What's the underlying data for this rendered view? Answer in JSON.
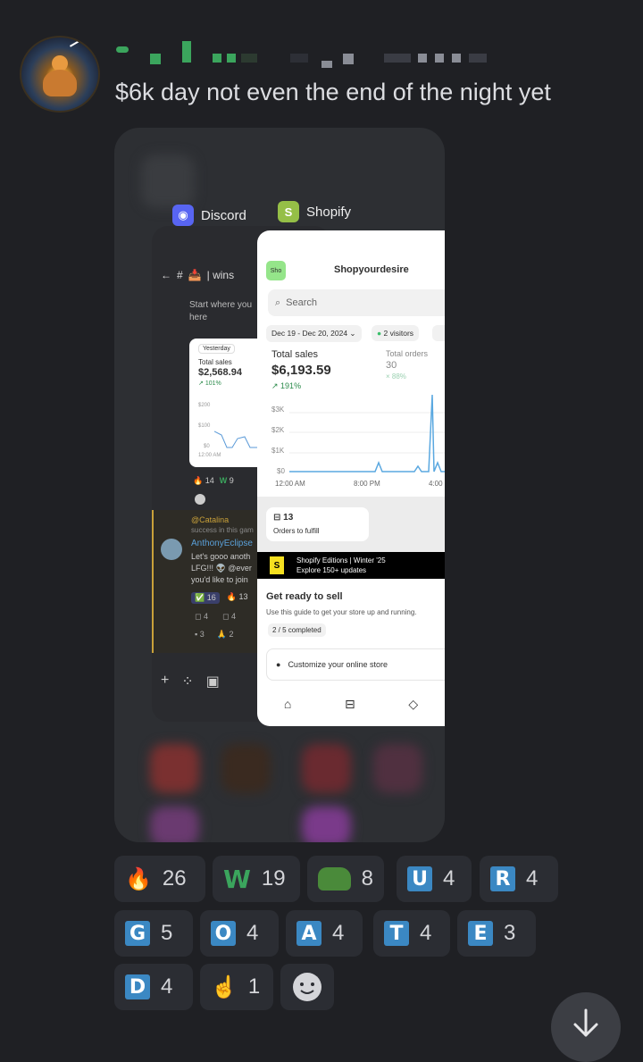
{
  "message": {
    "text": "$6k day not even the end of the night yet"
  },
  "screenshot": {
    "discord": {
      "app_name": "Discord",
      "channel": "| wins",
      "snippet_lines": [
        "Start where you",
        "here"
      ],
      "card": {
        "range": "Yesterday",
        "label": "Total sales",
        "value": "$2,568.94",
        "change": "101%",
        "ticks": [
          "$200",
          "$100",
          "$0"
        ],
        "time": "12:00 AM"
      },
      "reactions": [
        {
          "emoji": "🔥",
          "count": "14"
        },
        {
          "emoji": "W",
          "count": "9"
        }
      ],
      "reply": {
        "mention": "@Catalina",
        "sub": "success in this gam"
      },
      "author": "AnthonyEclipse",
      "body_lines": [
        "Let's gooo anoth",
        "LFG!!! 👽 @ever",
        "you'd like to join"
      ],
      "reactions2": [
        {
          "emoji": "✅",
          "count": "16"
        },
        {
          "emoji": "🔥",
          "count": "13"
        }
      ],
      "reactions3": [
        {
          "emoji": "",
          "count": "4"
        },
        {
          "emoji": "",
          "count": "4"
        }
      ],
      "reactions4": [
        {
          "emoji": "",
          "count": "3"
        },
        {
          "emoji": "🙏",
          "count": "2"
        }
      ]
    },
    "shopify": {
      "app_name": "Shopify",
      "store_badge": "Sho",
      "store_name": "Shopyourdesire",
      "search_placeholder": "Search",
      "date_range": "Dec 19 - Dec 20, 2024",
      "visitors": "2 visitors",
      "total_sales_label": "Total sales",
      "total_sales_value": "$6,193.59",
      "total_sales_change": "191%",
      "total_orders_label": "Total orders",
      "total_orders_value": "30",
      "total_orders_change": "88%",
      "y_ticks": [
        "$3K",
        "$2K",
        "$1K",
        "$0"
      ],
      "x_ticks": [
        "12:00 AM",
        "8:00 PM",
        "4:00"
      ],
      "orders_count": "13",
      "orders_label": "Orders to fulfill",
      "banner_line1": "Shopify Editions | Winter '25",
      "banner_line2": "Explore 150+ updates",
      "guide_title": "Get ready to sell",
      "guide_text": "Use this guide to get your store up and running.",
      "guide_progress": "2 / 5 completed",
      "guide_task": "Customize your online store"
    }
  },
  "reactions": [
    {
      "emoji": "🔥",
      "count": "26"
    },
    {
      "emoji": "W",
      "count": "19"
    },
    {
      "emoji": "pepe",
      "count": "8"
    },
    {
      "emoji": "U",
      "count": "4"
    },
    {
      "emoji": "R",
      "count": "4"
    },
    {
      "emoji": "G",
      "count": "5"
    },
    {
      "emoji": "O",
      "count": "4"
    },
    {
      "emoji": "A",
      "count": "4"
    },
    {
      "emoji": "T",
      "count": "4"
    },
    {
      "emoji": "E",
      "count": "3"
    },
    {
      "emoji": "D",
      "count": "4"
    },
    {
      "emoji": "☝️",
      "count": "1"
    }
  ],
  "colors": {
    "background": "#1f2024",
    "pill": "#2b2d33",
    "letter_blue": "#3b88c3",
    "green": "#3ba55d"
  },
  "icons": {
    "scroll_down": "arrow-down-icon",
    "add_reaction": "smiley-icon"
  }
}
